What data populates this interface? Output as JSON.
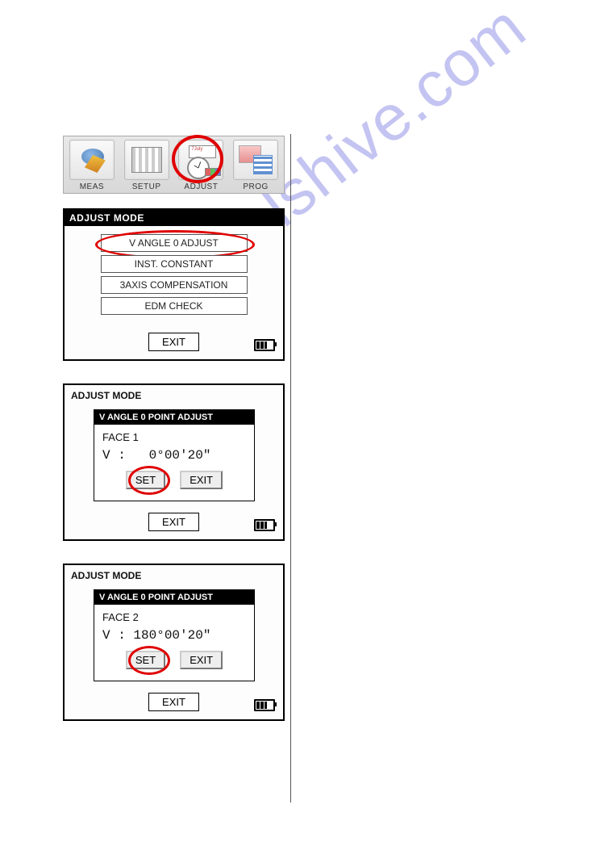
{
  "watermark": "manualshive.com",
  "toolbar": {
    "items": [
      {
        "label": "MEAS"
      },
      {
        "label": "SETUP"
      },
      {
        "label": "ADJUST"
      },
      {
        "label": "PROG"
      }
    ]
  },
  "panel1": {
    "title": "ADJUST MODE",
    "menu": [
      "V ANGLE 0 ADJUST",
      "INST. CONSTANT",
      "3AXIS COMPENSATION",
      "EDM CHECK"
    ],
    "exit": "EXIT"
  },
  "panel2": {
    "title": "ADJUST MODE",
    "dialog": {
      "title": "V ANGLE 0 POINT ADJUST",
      "face": "FACE 1",
      "vprefix": "V :",
      "vvalue": "  0°00'20\"",
      "set": "SET",
      "exit": "EXIT"
    },
    "exit": "EXIT"
  },
  "panel3": {
    "title": "ADJUST MODE",
    "dialog": {
      "title": "V ANGLE 0 POINT ADJUST",
      "face": "FACE 2",
      "vprefix": "V :",
      "vvalue": "180°00'20\"",
      "set": "SET",
      "exit": "EXIT"
    },
    "exit": "EXIT"
  }
}
